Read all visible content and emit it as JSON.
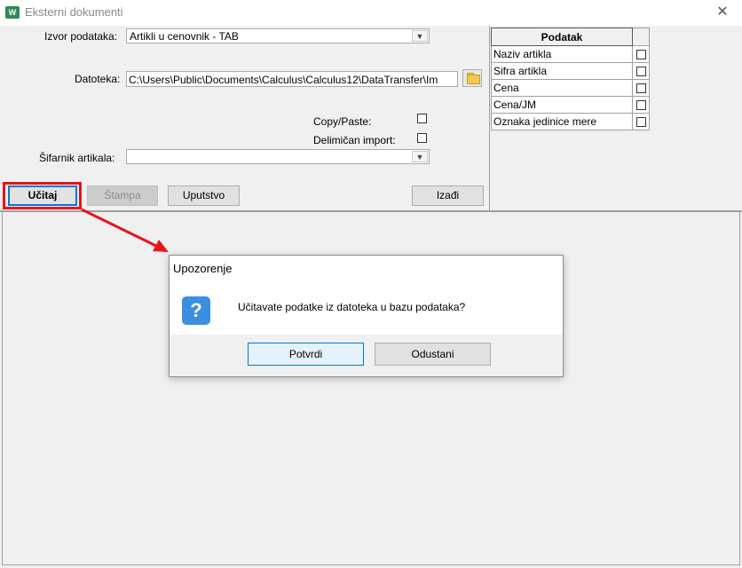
{
  "window": {
    "title": "Eksterni dokumenti",
    "app_icon_text": "W",
    "close_glyph": "✕"
  },
  "form": {
    "source_label": "Izvor podataka:",
    "source_value": "Artikli u cenovnik - TAB",
    "file_label": "Datoteka:",
    "file_value": "C:\\Users\\Public\\Documents\\Calculus\\Calculus12\\DataTransfer\\Im",
    "copy_paste_label": "Copy/Paste:",
    "partial_import_label": "Delimičan import:",
    "catalog_label": "Šifarnik artikala:",
    "catalog_value": ""
  },
  "buttons": {
    "load": "Učitaj",
    "print": "Štampa",
    "instructions": "Uputstvo",
    "exit": "Izađi"
  },
  "fields_table": {
    "header": "Podatak",
    "rows": [
      {
        "label": "Naziv artikla",
        "checked": false
      },
      {
        "label": "Sifra artikla",
        "checked": false
      },
      {
        "label": "Cena",
        "checked": false
      },
      {
        "label": "Cena/JM",
        "checked": false
      },
      {
        "label": "Oznaka jedinice mere",
        "checked": false
      }
    ]
  },
  "dialog": {
    "title": "Upozorenje",
    "icon": "question-icon",
    "message": "Učitavate podatke iz datoteka u bazu podataka?",
    "confirm": "Potvrdi",
    "cancel": "Odustani"
  },
  "colors": {
    "highlight": "#e8141b",
    "accent": "#0078d7",
    "question_icon": "#3b8ee0"
  }
}
